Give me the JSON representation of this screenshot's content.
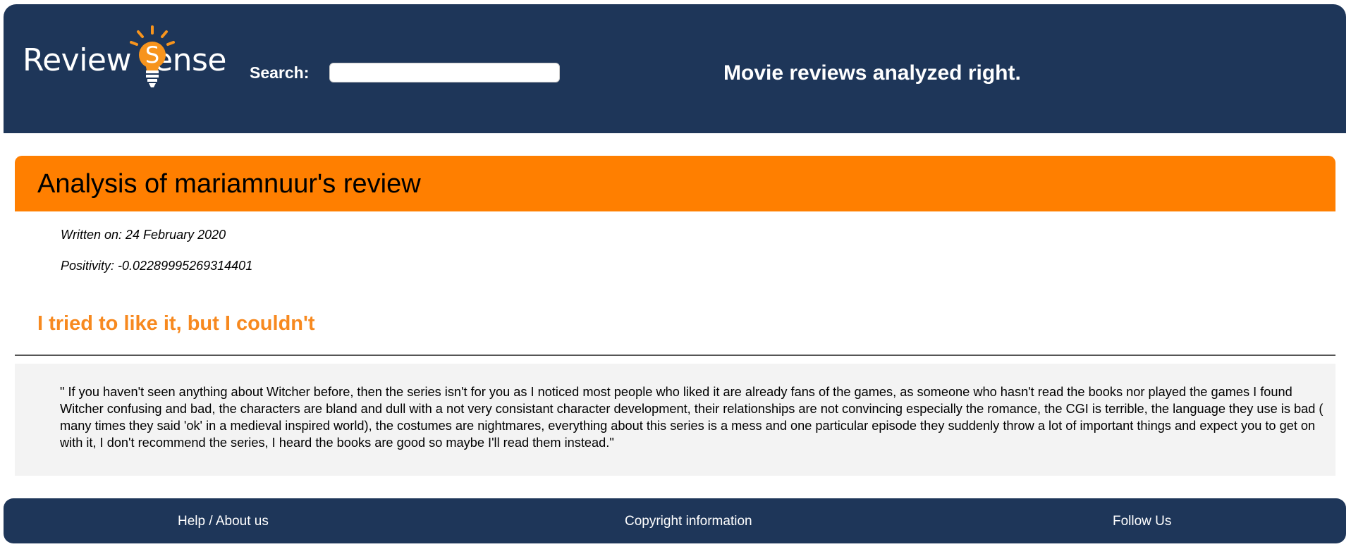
{
  "header": {
    "logo": {
      "text_prefix": "Review",
      "text_logo_letter": "S",
      "text_suffix": "ense"
    },
    "search_label": "Search:",
    "search_value": "",
    "tagline": "Movie reviews analyzed right."
  },
  "page": {
    "title": "Analysis of mariamnuur's review",
    "written_on": "Written on: 24 February 2020",
    "positivity": "Positivity: -0.02289995269314401",
    "review_title": "I tried to like it, but I couldn't",
    "review_text": "\" If you haven't seen anything about Witcher before, then the series isn't for you as I noticed most people who liked it are already fans of the games, as someone who hasn't read the books nor played the games I found Witcher confusing and bad, the characters are bland and dull with a not very consistant character development, their relationships are not convincing especially the romance, the CGI is terrible, the language they use is bad ( many times they said 'ok' in a medieval inspired world), the costumes are nightmares, everything about this series is a mess and one particular episode they suddenly throw a lot of important things and expect you to get on with it, I don't recommend the series, I heard the books are good so maybe I'll read them instead.\""
  },
  "footer": {
    "help": "Help / About us",
    "copyright": "Copyright information",
    "follow": "Follow Us"
  },
  "colors": {
    "navy": "#1e3659",
    "orange": "#ff7f00",
    "review_title_orange": "#f7891f",
    "review_bg": "#f3f3f3"
  },
  "icons": {
    "logo_bulb": "lightbulb-icon"
  }
}
